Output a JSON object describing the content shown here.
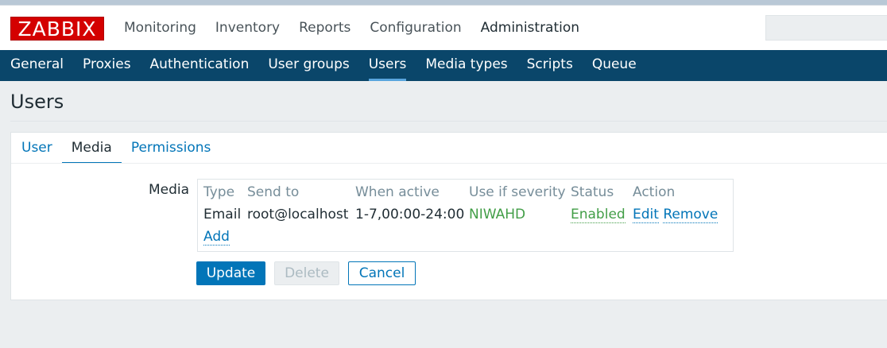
{
  "logo": "ZABBIX",
  "top_menu": [
    {
      "label": "Monitoring"
    },
    {
      "label": "Inventory"
    },
    {
      "label": "Reports"
    },
    {
      "label": "Configuration"
    },
    {
      "label": "Administration",
      "active": true
    }
  ],
  "sub_menu": [
    {
      "label": "General"
    },
    {
      "label": "Proxies"
    },
    {
      "label": "Authentication"
    },
    {
      "label": "User groups"
    },
    {
      "label": "Users",
      "active": true
    },
    {
      "label": "Media types"
    },
    {
      "label": "Scripts"
    },
    {
      "label": "Queue"
    }
  ],
  "page_title": "Users",
  "tabs": [
    {
      "label": "User"
    },
    {
      "label": "Media",
      "active": true
    },
    {
      "label": "Permissions"
    }
  ],
  "media": {
    "label": "Media",
    "headers": {
      "type": "Type",
      "send_to": "Send to",
      "when_active": "When active",
      "severity": "Use if severity",
      "status": "Status",
      "action": "Action"
    },
    "rows": [
      {
        "type": "Email",
        "send_to": "root@localhost",
        "when_active": "1-7,00:00-24:00",
        "severity": "NIWAHD",
        "status": "Enabled",
        "edit": "Edit",
        "remove": "Remove"
      }
    ],
    "add_label": "Add"
  },
  "buttons": {
    "update": "Update",
    "delete": "Delete",
    "cancel": "Cancel"
  },
  "colors": {
    "accent": "#0275b8",
    "nav": "#0a466a",
    "logo": "#d40000",
    "enabled": "#429e47"
  }
}
